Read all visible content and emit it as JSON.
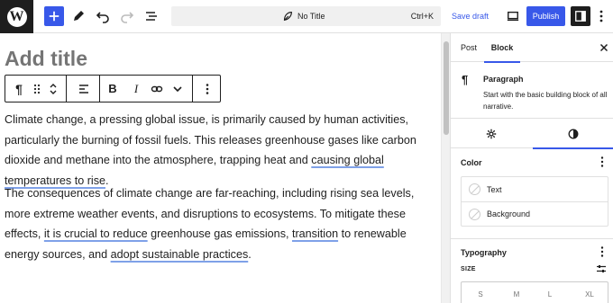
{
  "topbar": {
    "logo_letter": "W",
    "document_title": "No Title",
    "shortcut": "Ctrl+K",
    "save_draft": "Save draft",
    "publish": "Publish",
    "icons": [
      "wordpress-logo-icon",
      "plus-icon",
      "pencil-icon",
      "undo-icon",
      "redo-icon",
      "list-view-icon",
      "feather-icon",
      "desktop-preview-icon",
      "settings-panel-icon",
      "more-vertical-icon"
    ]
  },
  "editor": {
    "title_placeholder": "Add title",
    "block_toolbar": {
      "pilcrow": "¶",
      "bold": "B",
      "italic": "I"
    },
    "paragraph1": {
      "text_before": "Climate change, a pressing global issue, is primarily caused by human activities, particularly the burning of fossil fuels. This releases greenhouse gases like carbon dioxide and methane into the atmosphere, trapping heat and ",
      "link": "causing global temperatures to rise",
      "text_after": "."
    },
    "paragraph2": {
      "text_a": "The consequences of climate change are far-reaching, including rising sea levels, more extreme weather events, and disruptions to ecosystems. To mitigate these effects, ",
      "link_a": "it is crucial to reduce",
      "text_b": " greenhouse gas emissions, ",
      "link_b": "transition",
      "text_c": " to renewable energy sources, and ",
      "link_c": "adopt sustainable practices",
      "text_d": "."
    }
  },
  "sidebar": {
    "tab_post": "Post",
    "tab_block": "Block",
    "block_card": {
      "icon": "¶",
      "name": "Paragraph",
      "description": "Start with the basic building block of all narrative."
    },
    "color": {
      "title": "Color",
      "items": [
        {
          "label": "Text"
        },
        {
          "label": "Background"
        }
      ]
    },
    "typography": {
      "title": "Typography",
      "size_label": "SIZE",
      "sizes": [
        "S",
        "M",
        "L",
        "XL"
      ]
    }
  },
  "colors": {
    "accent": "#3858e9",
    "dark": "#1e1e1e",
    "link_underline": "#7fa1e8"
  }
}
